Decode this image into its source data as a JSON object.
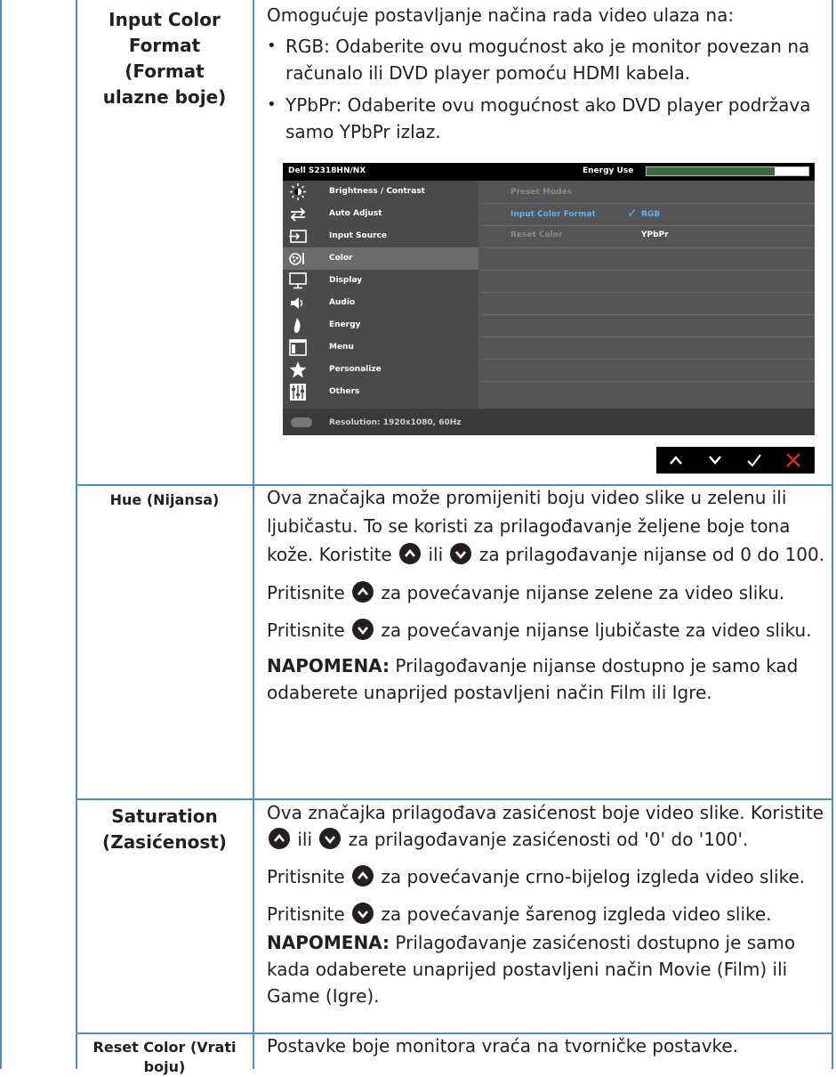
{
  "rows": [
    {
      "label": "Input Color Format (Format ulazne boje)",
      "intro": "Omogućuje postavljanje načina rada video ulaza na:",
      "bullets": [
        "RGB: Odaberite ovu mogućnost ako je monitor povezan na računalo ili DVD player pomoću HDMI kabela.",
        "YPbPr: Odaberite ovu mogućnost ako DVD player podržava samo YPbPr izlaz."
      ]
    },
    {
      "label": "Hue (Nijansa)",
      "p1_a": "Ova značajka može promijeniti boju video slike u zelenu ili ljubičastu. To se koristi za prilagođavanje željene boje tona kože. Koristite",
      "p1_b": "ili",
      "p1_c": "za prilagođavanje nijanse od 0 do 100.",
      "p2_a": "Pritisnite",
      "p2_b": "za povećavanje nijanse zelene za video sliku.",
      "p3_a": "Pritisnite",
      "p3_b": "za povećavanje nijanse ljubičaste za video sliku.",
      "note_label": "NAPOMENA:",
      "note_text": "Prilagođavanje nijanse dostupno je samo kad odaberete unaprijed postavljeni način Film ili Igre."
    },
    {
      "label": "Saturation (Zasićenost)",
      "p1_a": "Ova značajka prilagođava zasićenost boje video slike. Koristite",
      "p1_b": "ili",
      "p1_c": "za prilagođavanje zasićenosti od '0' do '100'.",
      "p2_a": "Pritisnite",
      "p2_b": "za povećavanje crno-bijelog izgleda video slike.",
      "p3_a": "Pritisnite",
      "p3_b": "za povećavanje šarenog izgleda video slike.",
      "note_label": "NAPOMENA:",
      "note_text": "Prilagođavanje zasićenosti dostupno je samo kada odaberete unaprijed postavljeni način Movie (Film) ili Game (Igre)."
    },
    {
      "label": "Reset Color (Vrati boju)",
      "text": "Postavke boje monitora vraća na tvorničke postavke."
    }
  ],
  "osd": {
    "title": "Dell S2318HN/NX",
    "energy_label": "Energy Use",
    "energy_level": 0.79,
    "menu": [
      {
        "label": "Brightness / Contrast",
        "icon": "brightness-icon"
      },
      {
        "label": "Auto Adjust",
        "icon": "auto-adjust-icon"
      },
      {
        "label": "Input Source",
        "icon": "input-source-icon"
      },
      {
        "label": "Color",
        "icon": "color-icon"
      },
      {
        "label": "Display",
        "icon": "display-icon"
      },
      {
        "label": "Audio",
        "icon": "audio-icon"
      },
      {
        "label": "Energy",
        "icon": "energy-icon"
      },
      {
        "label": "Menu",
        "icon": "menu-icon"
      },
      {
        "label": "Personalize",
        "icon": "personalize-icon"
      },
      {
        "label": "Others",
        "icon": "others-icon"
      }
    ],
    "selected_menu": "Color",
    "submenu": {
      "preset_modes": "Preset Modes",
      "input_color_format": "Input Color Format",
      "check": "✓",
      "rgb": "RGB",
      "reset_color": "Reset Color",
      "ypbpr": "YPbPr"
    },
    "resolution": "Resolution: 1920x1080, 60Hz",
    "nav_buttons": [
      "up-icon",
      "down-icon",
      "check-icon",
      "close-icon"
    ],
    "accent": "#4b8fc9",
    "close_color": "#e0262b"
  }
}
